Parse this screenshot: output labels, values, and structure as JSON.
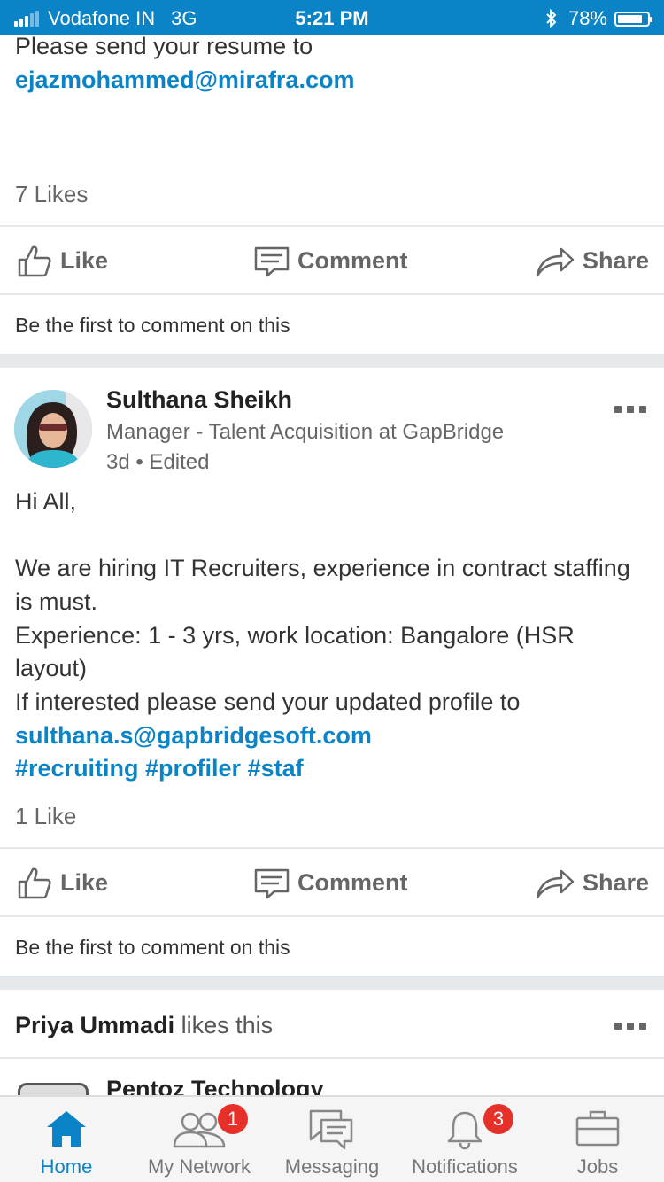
{
  "status_bar": {
    "carrier": "Vodafone IN",
    "network": "3G",
    "time": "5:21 PM",
    "battery": "78%",
    "battery_level": 0.78
  },
  "post1": {
    "body_line": "Please send your resume to",
    "email": "ejazmohammed@mirafra.com",
    "likes": "7 Likes",
    "first_comment": "Be the first to comment on this"
  },
  "actions": {
    "like": "Like",
    "comment": "Comment",
    "share": "Share"
  },
  "post2": {
    "author": "Sulthana Sheikh",
    "headline": "Manager - Talent Acquisition at GapBridge",
    "meta": "3d • Edited",
    "line1": "Hi All,",
    "line2": "We are hiring IT Recruiters, experience in contract staffing",
    "line3": "is must.",
    "line4": "Experience: 1 - 3 yrs, work location: Bangalore (HSR",
    "line5": "layout)",
    "line6": "If interested please send your updated profile to",
    "email": "sulthana.s@gapbridgesoft.com",
    "hashtags": "#recruiting #profiler #staf",
    "likes": "1 Like",
    "first_comment": "Be the first to comment on this"
  },
  "post3": {
    "liker": "Priya Ummadi",
    "liker_suffix": " likes this",
    "company": "Pentoz Technology"
  },
  "tabbar": {
    "home": "Home",
    "network": "My Network",
    "network_badge": "1",
    "messaging": "Messaging",
    "notifications": "Notifications",
    "notifications_badge": "3",
    "jobs": "Jobs"
  },
  "colors": {
    "accent": "#0a84c6",
    "badge": "#e6302a"
  }
}
